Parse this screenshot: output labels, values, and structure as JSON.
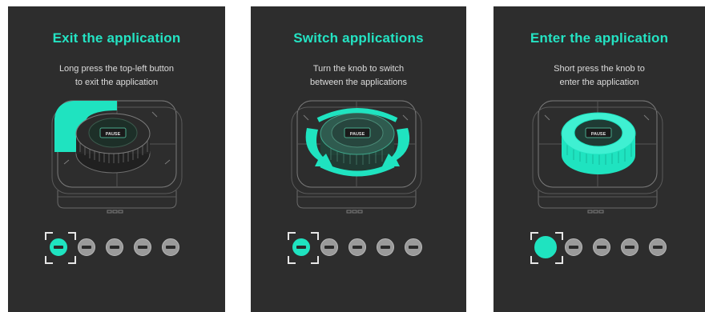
{
  "panels": [
    {
      "title": "Exit the application",
      "desc_line1": "Long press the top-left button",
      "desc_line2": "to exit the application",
      "knob_label": "PAUSE",
      "dot_labels": [
        "PAUSE",
        "PAUSE",
        "PAUSE",
        "PAUSE",
        "PAUSE"
      ]
    },
    {
      "title": "Switch applications",
      "desc_line1": "Turn the knob to switch",
      "desc_line2": "between the applications",
      "knob_label": "PAUSE",
      "dot_labels": [
        "PAUSE",
        "PAUSE",
        "PAUSE",
        "PAUSE",
        "PAUSE"
      ]
    },
    {
      "title": "Enter the application",
      "desc_line1": "Short press the knob to",
      "desc_line2": "enter the application",
      "knob_label": "PAUSE",
      "dot_labels": [
        "PAUSE",
        "PAUSE",
        "PAUSE",
        "PAUSE"
      ]
    }
  ],
  "colors": {
    "accent": "#24e3c3",
    "panel_bg": "#2d2d2d",
    "line": "#8a8a8a"
  }
}
